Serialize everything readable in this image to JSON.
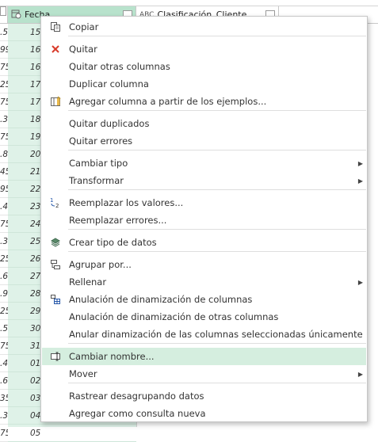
{
  "grid": {
    "headers": {
      "date_column": "Fecha",
      "class_column": "Clasificación_Cliente",
      "class_type": "ABC"
    },
    "left_values": [
      ".5",
      "99",
      "75",
      "25",
      "75",
      ".3",
      "75",
      ".8",
      "45",
      "95",
      ".4",
      "75",
      ".3",
      "25",
      ".6",
      ".9",
      "25",
      ".5",
      "75",
      ".4",
      ".6",
      "35",
      ".3",
      "75"
    ],
    "date_values": [
      "15",
      "16",
      "16",
      "17",
      "17",
      "18",
      "19",
      "20",
      "21",
      "22",
      "23",
      "24",
      "25",
      "26",
      "27",
      "28",
      "29",
      "30",
      "31",
      "01",
      "02",
      "03",
      "04",
      "05"
    ]
  },
  "menu": {
    "items": [
      {
        "id": "copiar",
        "label": "Copiar",
        "icon": "copy-icon"
      },
      {
        "id": "quitar",
        "label": "Quitar",
        "icon": "remove-x-icon"
      },
      {
        "id": "quitar-otras",
        "label": "Quitar otras columnas",
        "icon": ""
      },
      {
        "id": "duplicar",
        "label": "Duplicar columna",
        "icon": ""
      },
      {
        "id": "agregar-ejemplos",
        "label": "Agregar columna a partir de los ejemplos...",
        "icon": "column-from-examples-icon"
      },
      {
        "id": "quitar-duplicados",
        "label": "Quitar duplicados",
        "icon": ""
      },
      {
        "id": "quitar-errores",
        "label": "Quitar errores",
        "icon": ""
      },
      {
        "id": "cambiar-tipo",
        "label": "Cambiar tipo",
        "icon": "",
        "submenu": true
      },
      {
        "id": "transformar",
        "label": "Transformar",
        "icon": "",
        "submenu": true
      },
      {
        "id": "reemplazar-valores",
        "label": "Reemplazar los valores...",
        "icon": "replace-values-icon"
      },
      {
        "id": "reemplazar-errores",
        "label": "Reemplazar errores...",
        "icon": ""
      },
      {
        "id": "crear-tipo",
        "label": "Crear tipo de datos",
        "icon": "data-type-icon"
      },
      {
        "id": "agrupar",
        "label": "Agrupar por...",
        "icon": "group-by-icon"
      },
      {
        "id": "rellenar",
        "label": "Rellenar",
        "icon": "",
        "submenu": true
      },
      {
        "id": "anulacion",
        "label": "Anulación de dinamización de columnas",
        "icon": "unpivot-icon"
      },
      {
        "id": "anulacion-otras",
        "label": "Anulación de dinamización de otras columnas",
        "icon": ""
      },
      {
        "id": "anular-seleccionadas",
        "label": "Anular dinamización de las columnas seleccionadas únicamente",
        "icon": ""
      },
      {
        "id": "cambiar-nombre",
        "label": "Cambiar nombre...",
        "icon": "rename-icon",
        "highlighted": true
      },
      {
        "id": "mover",
        "label": "Mover",
        "icon": "",
        "submenu": true
      },
      {
        "id": "rastrear",
        "label": "Rastrear desagrupando datos",
        "icon": ""
      },
      {
        "id": "agregar-consulta",
        "label": "Agregar como consulta nueva",
        "icon": ""
      }
    ],
    "accent_color": "#d5eedf",
    "submenu_arrow": "▶"
  }
}
